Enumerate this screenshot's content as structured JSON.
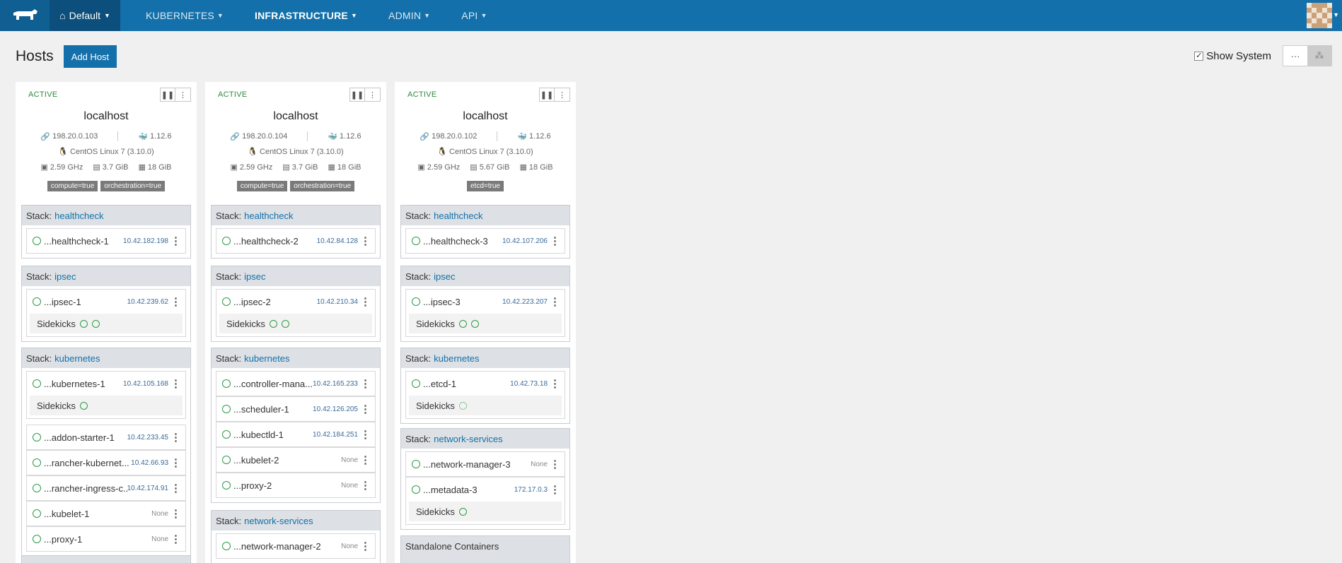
{
  "header": {
    "environment": "Default",
    "nav": [
      {
        "label": "KUBERNETES",
        "active": false
      },
      {
        "label": "INFRASTRUCTURE",
        "active": true
      },
      {
        "label": "ADMIN",
        "active": false
      },
      {
        "label": "API",
        "active": false
      }
    ]
  },
  "page": {
    "title": "Hosts",
    "add_host_label": "Add Host",
    "show_system_label": "Show System",
    "show_system_checked": true
  },
  "hosts": [
    {
      "state": "ACTIVE",
      "name": "localhost",
      "ip": "198.20.0.103",
      "docker_version": "1.12.6",
      "os": "CentOS Linux 7 (3.10.0)",
      "cpu": "2.59 GHz",
      "memory": "3.7 GiB",
      "disk": "18 GiB",
      "labels": [
        "compute=true",
        "orchestration=true"
      ],
      "stacks": {
        "s1": {
          "prefix": "Stack:",
          "name": "healthcheck",
          "c1": {
            "name": "...healthcheck-1",
            "ip": "10.42.182.198"
          }
        },
        "s2": {
          "prefix": "Stack:",
          "name": "ipsec",
          "c1": {
            "name": "...ipsec-1",
            "ip": "10.42.239.62"
          },
          "sidekicks": "Sidekicks"
        },
        "s3": {
          "prefix": "Stack:",
          "name": "kubernetes",
          "c1": {
            "name": "...kubernetes-1",
            "ip": "10.42.105.168"
          },
          "sidekicks": "Sidekicks",
          "c2": {
            "name": "...addon-starter-1",
            "ip": "10.42.233.45"
          },
          "c3": {
            "name": "...rancher-kubernet...",
            "ip": "10.42.66.93"
          },
          "c4": {
            "name": "...rancher-ingress-c...",
            "ip": "10.42.174.91"
          },
          "c5": {
            "name": "...kubelet-1",
            "ip": "None"
          },
          "c6": {
            "name": "...proxy-1",
            "ip": "None"
          }
        }
      }
    },
    {
      "state": "ACTIVE",
      "name": "localhost",
      "ip": "198.20.0.104",
      "docker_version": "1.12.6",
      "os": "CentOS Linux 7 (3.10.0)",
      "cpu": "2.59 GHz",
      "memory": "3.7 GiB",
      "disk": "18 GiB",
      "labels": [
        "compute=true",
        "orchestration=true"
      ],
      "stacks": {
        "s1": {
          "prefix": "Stack:",
          "name": "healthcheck",
          "c1": {
            "name": "...healthcheck-2",
            "ip": "10.42.84.128"
          }
        },
        "s2": {
          "prefix": "Stack:",
          "name": "ipsec",
          "c1": {
            "name": "...ipsec-2",
            "ip": "10.42.210.34"
          },
          "sidekicks": "Sidekicks"
        },
        "s3": {
          "prefix": "Stack:",
          "name": "kubernetes",
          "c1": {
            "name": "...controller-mana...",
            "ip": "10.42.165.233"
          },
          "c2": {
            "name": "...scheduler-1",
            "ip": "10.42.126.205"
          },
          "c3": {
            "name": "...kubectld-1",
            "ip": "10.42.184.251"
          },
          "c4": {
            "name": "...kubelet-2",
            "ip": "None"
          },
          "c5": {
            "name": "...proxy-2",
            "ip": "None"
          }
        },
        "s4": {
          "prefix": "Stack:",
          "name": "network-services",
          "c1": {
            "name": "...network-manager-2",
            "ip": "None"
          }
        }
      }
    },
    {
      "state": "ACTIVE",
      "name": "localhost",
      "ip": "198.20.0.102",
      "docker_version": "1.12.6",
      "os": "CentOS Linux 7 (3.10.0)",
      "cpu": "2.59 GHz",
      "memory": "5.67 GiB",
      "disk": "18 GiB",
      "labels": [
        "etcd=true"
      ],
      "stacks": {
        "s1": {
          "prefix": "Stack:",
          "name": "healthcheck",
          "c1": {
            "name": "...healthcheck-3",
            "ip": "10.42.107.206"
          }
        },
        "s2": {
          "prefix": "Stack:",
          "name": "ipsec",
          "c1": {
            "name": "...ipsec-3",
            "ip": "10.42.223.207"
          },
          "sidekicks": "Sidekicks"
        },
        "s3": {
          "prefix": "Stack:",
          "name": "kubernetes",
          "c1": {
            "name": "...etcd-1",
            "ip": "10.42.73.18"
          },
          "sidekicks": "Sidekicks"
        },
        "s4": {
          "prefix": "Stack:",
          "name": "network-services",
          "c1": {
            "name": "...network-manager-3",
            "ip": "None"
          },
          "c2": {
            "name": "...metadata-3",
            "ip": "172.17.0.3"
          },
          "sidekicks": "Sidekicks"
        },
        "standalone": "Standalone Containers"
      }
    }
  ]
}
